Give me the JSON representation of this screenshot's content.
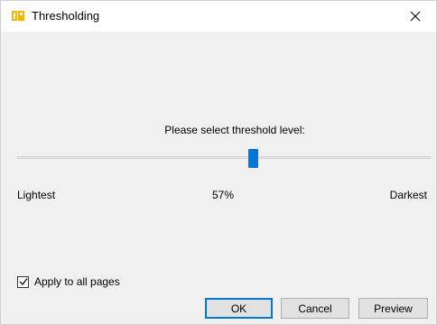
{
  "window": {
    "title": "Thresholding",
    "app_icon": "app-logo-icon",
    "close_icon": "close-icon"
  },
  "threshold": {
    "prompt": "Please select threshold level:",
    "label_left": "Lightest",
    "label_right": "Darkest",
    "value_text": "57%",
    "value_fraction": 0.57
  },
  "apply_all": {
    "label": "Apply to all pages",
    "checked": true
  },
  "buttons": {
    "ok": "OK",
    "cancel": "Cancel",
    "preview": "Preview"
  },
  "colors": {
    "accent": "#0078d7",
    "icon": "#f5b400"
  }
}
